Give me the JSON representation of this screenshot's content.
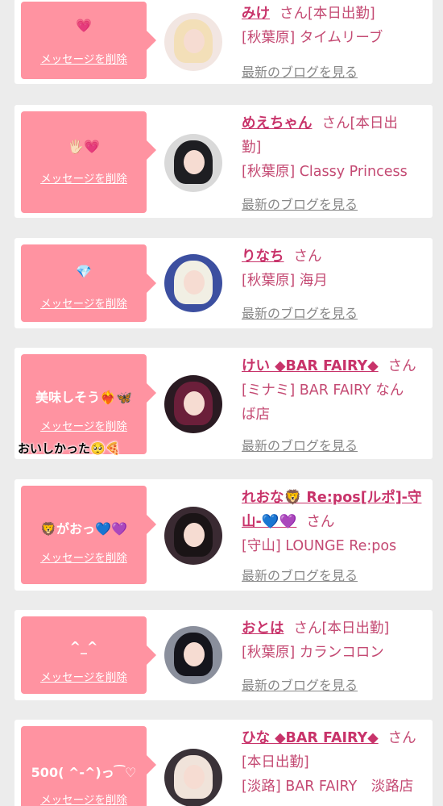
{
  "cards": [
    {
      "message": "💗",
      "delete_label": "メッセージを削除",
      "name": "みけ",
      "san": "さん",
      "status": "[本日出勤]",
      "shop": "[秋葉原] タイムリーブ",
      "blog_label": "最新のブログを見る",
      "avatar_colors": {
        "bg": "#f2e6e2",
        "hair": "#f3dfb8"
      }
    },
    {
      "message": "🖐🏻💗",
      "delete_label": "メッセージを削除",
      "name": "めえちゃん",
      "san": "さん",
      "status": "[本日出",
      "status_cont": "勤]",
      "shop": "[秋葉原] Classy Princess",
      "blog_label": "最新のブログを見る",
      "avatar_colors": {
        "bg": "#d9d9d9",
        "hair": "#1e1e22"
      }
    },
    {
      "message": "💎",
      "delete_label": "メッセージを削除",
      "name": "りなち",
      "san": "さん",
      "shop": "[秋葉原] 海月",
      "blog_label": "最新のブログを見る",
      "avatar_colors": {
        "bg": "#3c4fa0",
        "hair": "#f1efe4"
      }
    },
    {
      "message": "美味しそう❤️‍🔥🦋",
      "delete_label": "メッセージを削除",
      "sticker": "おいしかった🥺🍕",
      "name": "けい ◆BAR FAIRY◆",
      "san": "さん",
      "shop": "[ミナミ] BAR FAIRY なん",
      "shop_cont": "ば店",
      "blog_label": "最新のブログを見る",
      "avatar_colors": {
        "bg": "#2a1a22",
        "hair": "#6b1f3a"
      }
    },
    {
      "message": "🦁がおっ💙💜",
      "delete_label": "メッセージを削除",
      "name": "れおな🦁 Re:pos[ルポ]-守",
      "name_cont": "山-💙💜",
      "san": "さん",
      "shop": "[守山] LOUNGE Re:pos",
      "blog_label": "最新のブログを見る",
      "avatar_colors": {
        "bg": "#3a2a32",
        "hair": "#1a1416"
      }
    },
    {
      "message": "^_^",
      "delete_label": "メッセージを削除",
      "name": "おとは",
      "san": "さん",
      "status": "[本日出勤]",
      "shop": "[秋葉原] カランコロン",
      "blog_label": "最新のブログを見る",
      "avatar_colors": {
        "bg": "#8a8f9c",
        "hair": "#15151c"
      }
    },
    {
      "message": "500( ^-^)っ⁀♡",
      "delete_label": "メッセージを削除",
      "name": "ひな ◆BAR FAIRY◆",
      "san": "さん",
      "status": "[本日出勤]",
      "shop": "[淡路] BAR FAIRY　淡路店",
      "avatar_colors": {
        "bg": "#3a3238",
        "hair": "#f0e3da"
      }
    }
  ],
  "colors": {
    "bubble": "#ff93a1",
    "name": "#c8336a",
    "text": "#c44a73",
    "link": "#888888"
  }
}
